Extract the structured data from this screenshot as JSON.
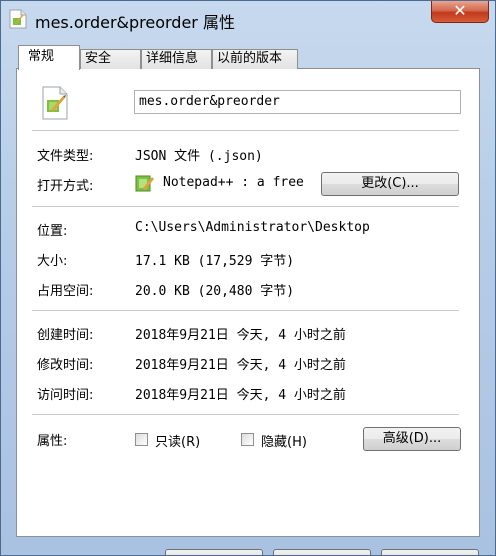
{
  "window": {
    "title": "mes.order&preorder 属性",
    "close_label": "✕"
  },
  "tabs": [
    {
      "label": "常规",
      "active": true
    },
    {
      "label": "安全",
      "active": false
    },
    {
      "label": "详细信息",
      "active": false
    },
    {
      "label": "以前的版本",
      "active": false
    }
  ],
  "file": {
    "name": "mes.order&preorder",
    "type_label": "文件类型:",
    "type_value": "JSON 文件 (.json)",
    "open_with_label": "打开方式:",
    "open_with_value": "Notepad++ : a free",
    "change_button": "更改(C)...",
    "location_label": "位置:",
    "location_value": "C:\\Users\\Administrator\\Desktop",
    "size_label": "大小:",
    "size_value": "17.1 KB (17,529 字节)",
    "disk_size_label": "占用空间:",
    "disk_size_value": "20.0 KB (20,480 字节)",
    "created_label": "创建时间:",
    "created_value": "2018年9月21日 今天, 4 小时之前",
    "modified_label": "修改时间:",
    "modified_value": "2018年9月21日 今天, 4 小时之前",
    "accessed_label": "访问时间:",
    "accessed_value": "2018年9月21日 今天, 4 小时之前",
    "attributes_label": "属性:",
    "readonly_label": "只读(R)",
    "readonly_checked": false,
    "hidden_label": "隐藏(H)",
    "hidden_checked": false,
    "advanced_button": "高级(D)..."
  },
  "icons": {
    "file_icon": "notepadpp-file-icon",
    "app_icon": "notepadpp-icon"
  }
}
